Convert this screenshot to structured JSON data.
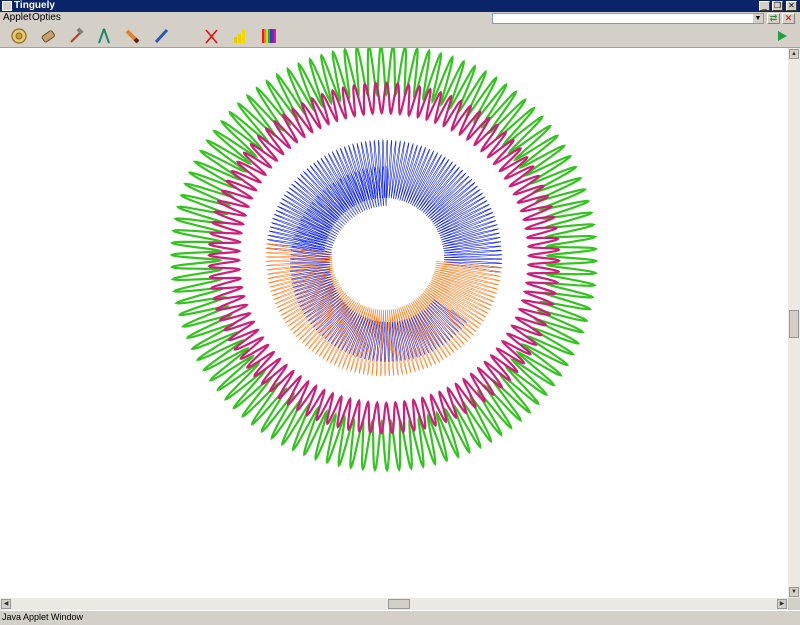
{
  "window": {
    "title": "Tinguely"
  },
  "menu": [
    "Applet",
    "Opties"
  ],
  "combo": {
    "value": ""
  },
  "toolbar": {
    "tools": [
      "gear-icon",
      "eraser-icon",
      "hammer-icon",
      "compass-icon",
      "pencil-icon",
      "pen-icon",
      "delete-icon",
      "chart-icon",
      "color-palette-icon"
    ],
    "run": "play-icon"
  },
  "drawing": {
    "rings": [
      {
        "name": "green-ring",
        "color": "#33c41f"
      },
      {
        "name": "magenta-ring",
        "color": "#cc1f7a"
      },
      {
        "name": "blue-ring",
        "color": "#0a1ee8"
      },
      {
        "name": "orange-ring",
        "color": "#ff7f1f"
      }
    ]
  },
  "status": {
    "text": "Java Applet Window"
  }
}
